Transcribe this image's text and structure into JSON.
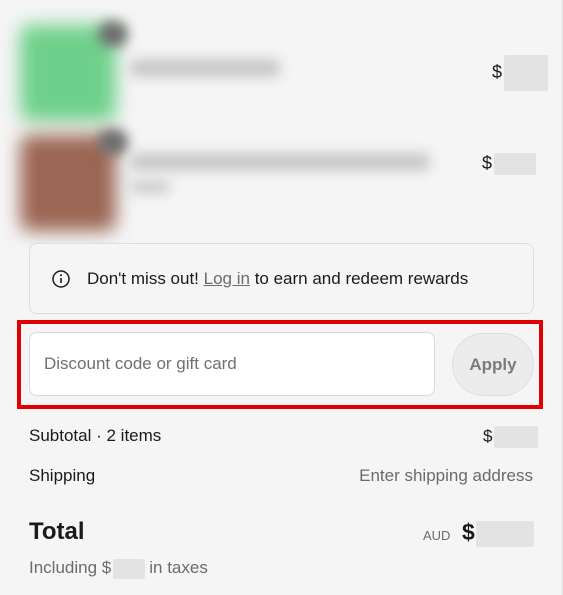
{
  "products": [
    {
      "price_symbol": "$"
    },
    {
      "price_symbol": "$"
    }
  ],
  "rewards": {
    "prefix": "Don't miss out!",
    "link": "Log in",
    "suffix": "to earn and redeem rewards",
    "icon": "info-icon"
  },
  "discount": {
    "placeholder": "Discount code or gift card",
    "value": "",
    "apply_label": "Apply"
  },
  "summary": {
    "subtotal_label": "Subtotal · 2 items",
    "subtotal_symbol": "$",
    "shipping_label": "Shipping",
    "shipping_value": "Enter shipping address",
    "total_label": "Total",
    "currency": "AUD",
    "total_symbol": "$",
    "taxes_prefix": "Including $",
    "taxes_suffix": "in taxes"
  },
  "colors": {
    "highlight": "#e00000",
    "background": "#f5f5f5",
    "muted_text": "#6b6b6b"
  }
}
